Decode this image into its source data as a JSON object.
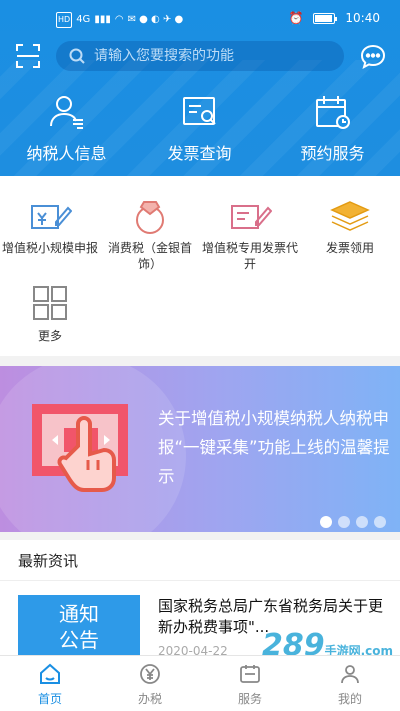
{
  "status_bar": {
    "carrier_badge": "HD",
    "network": "4G",
    "time": "10:40"
  },
  "search": {
    "placeholder": "请输入您要搜索的功能"
  },
  "top_nav": [
    {
      "label": "纳税人信息",
      "icon": "taxpayer-info-icon"
    },
    {
      "label": "发票查询",
      "icon": "invoice-query-icon"
    },
    {
      "label": "预约服务",
      "icon": "appointment-icon"
    }
  ],
  "services": [
    {
      "label": "增值税小规模申报",
      "icon": "vat-small-scale-icon"
    },
    {
      "label": "消费税（金银首饰）",
      "icon": "consumption-tax-icon"
    },
    {
      "label": "增值税专用发票代开",
      "icon": "vat-special-invoice-icon"
    },
    {
      "label": "发票领用",
      "icon": "invoice-collect-icon"
    },
    {
      "label": "更多",
      "icon": "more-grid-icon"
    }
  ],
  "banner": {
    "text": "关于增值税小规模纳税人纳税申报“一键采集”功能上线的温馨提示",
    "slide_count": 4,
    "active_slide": 0
  },
  "news": {
    "section_title": "最新资讯",
    "thumb_label_line1": "通知",
    "thumb_label_line2": "公告",
    "headline": "国家税务总局广东省税务局关于更新办税费事项\"...",
    "date": "2020-04-22"
  },
  "watermark": {
    "text": "289",
    "sub": "手游网.com"
  },
  "tabbar": [
    {
      "label": "首页",
      "icon": "home-icon",
      "active": true
    },
    {
      "label": "办税",
      "icon": "tax-yen-icon",
      "active": false
    },
    {
      "label": "服务",
      "icon": "service-icon",
      "active": false
    },
    {
      "label": "我的",
      "icon": "profile-icon",
      "active": false
    }
  ],
  "colors": {
    "primary": "#1a8fe3",
    "banner_start": "#bd8ee0",
    "banner_end": "#7fb3f6"
  }
}
